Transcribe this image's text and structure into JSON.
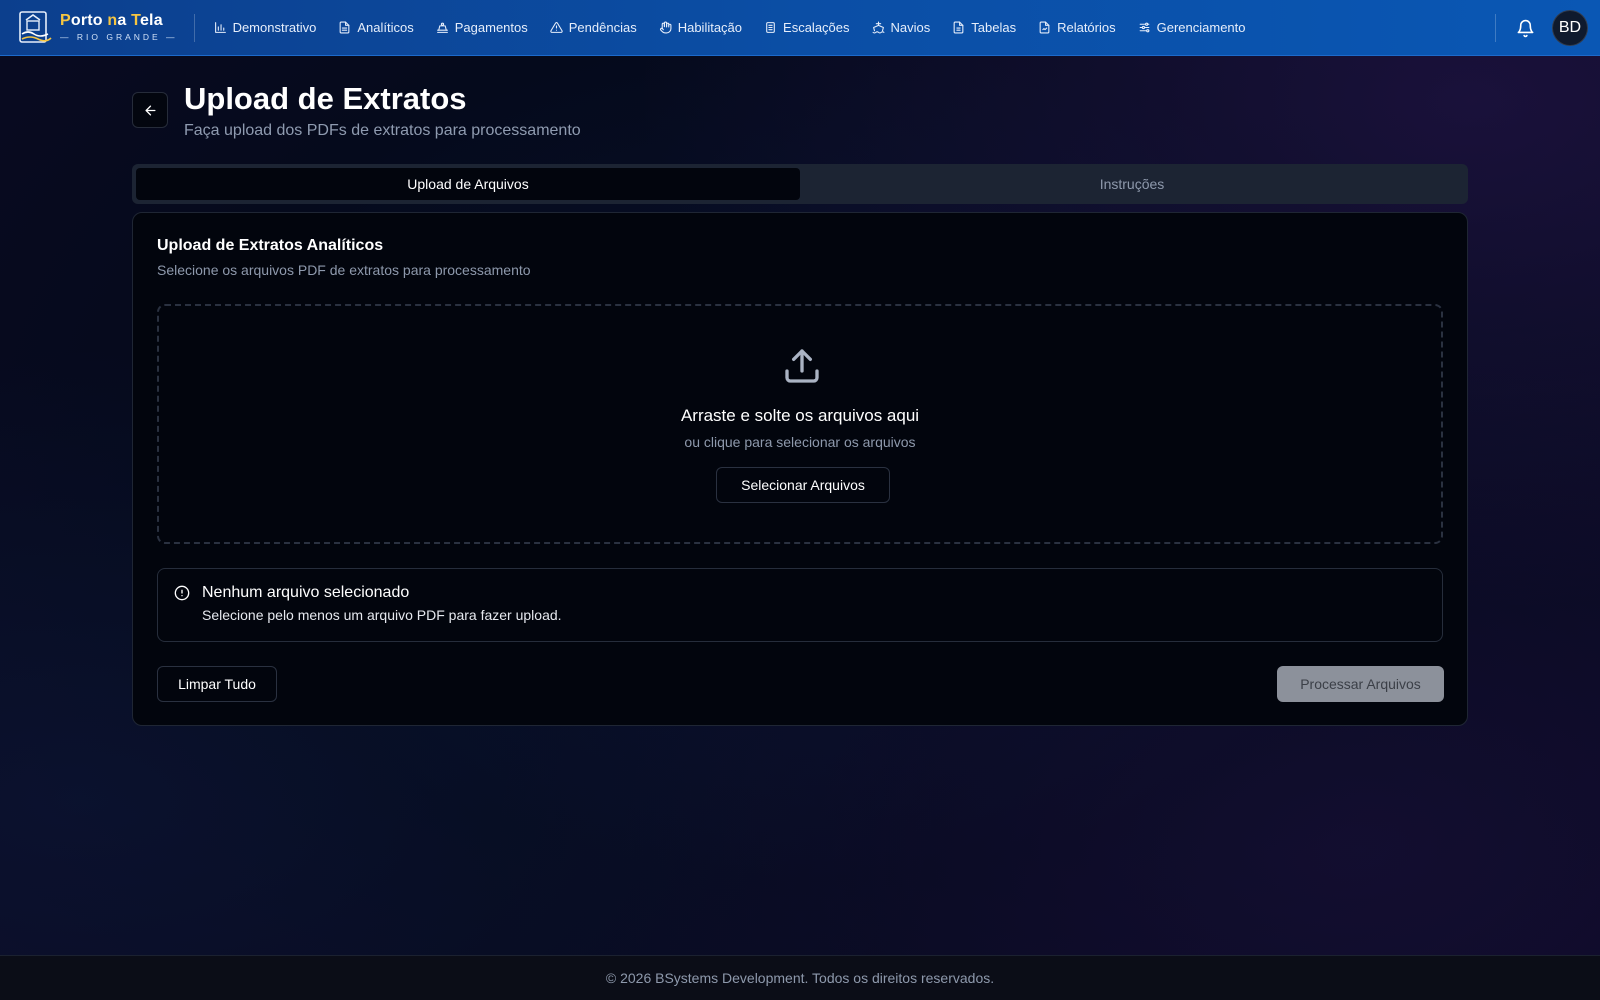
{
  "brand": {
    "name_parts": [
      {
        "text": "P",
        "accent": true
      },
      {
        "text": "orto ",
        "accent": false
      },
      {
        "text": "n",
        "accent": true
      },
      {
        "text": "a ",
        "accent": false
      },
      {
        "text": "T",
        "accent": true
      },
      {
        "text": "ela",
        "accent": false
      }
    ],
    "subtitle": "— RIO GRANDE —",
    "accent_color": "#f5c542"
  },
  "nav": {
    "items": [
      {
        "label": "Demonstrativo",
        "icon": "bar-chart-icon"
      },
      {
        "label": "Analíticos",
        "icon": "file-text-icon"
      },
      {
        "label": "Pagamentos",
        "icon": "hand-coins-icon"
      },
      {
        "label": "Pendências",
        "icon": "alert-triangle-icon"
      },
      {
        "label": "Habilitação",
        "icon": "hand-icon"
      },
      {
        "label": "Escalações",
        "icon": "clipboard-icon"
      },
      {
        "label": "Navios",
        "icon": "ship-icon"
      },
      {
        "label": "Tabelas",
        "icon": "file-icon"
      },
      {
        "label": "Relatórios",
        "icon": "file-chart-icon"
      },
      {
        "label": "Gerenciamento",
        "icon": "sliders-icon"
      }
    ]
  },
  "user": {
    "initials": "BD"
  },
  "header": {
    "title": "Upload de Extratos",
    "subtitle": "Faça upload dos PDFs de extratos para processamento"
  },
  "tabs": [
    {
      "label": "Upload de Arquivos",
      "active": true
    },
    {
      "label": "Instruções",
      "active": false
    }
  ],
  "card": {
    "title": "Upload de Extratos Analíticos",
    "description": "Selecione os arquivos PDF de extratos para processamento",
    "dropzone": {
      "title": "Arraste e solte os arquivos aqui",
      "subtitle": "ou clique para selecionar os arquivos",
      "button": "Selecionar Arquivos"
    },
    "alert": {
      "title": "Nenhum arquivo selecionado",
      "description": "Selecione pelo menos um arquivo PDF para fazer upload."
    },
    "clear_button": "Limpar Tudo",
    "process_button": "Processar Arquivos"
  },
  "footer": {
    "text": "© 2026 BSystems Development. Todos os direitos reservados."
  }
}
